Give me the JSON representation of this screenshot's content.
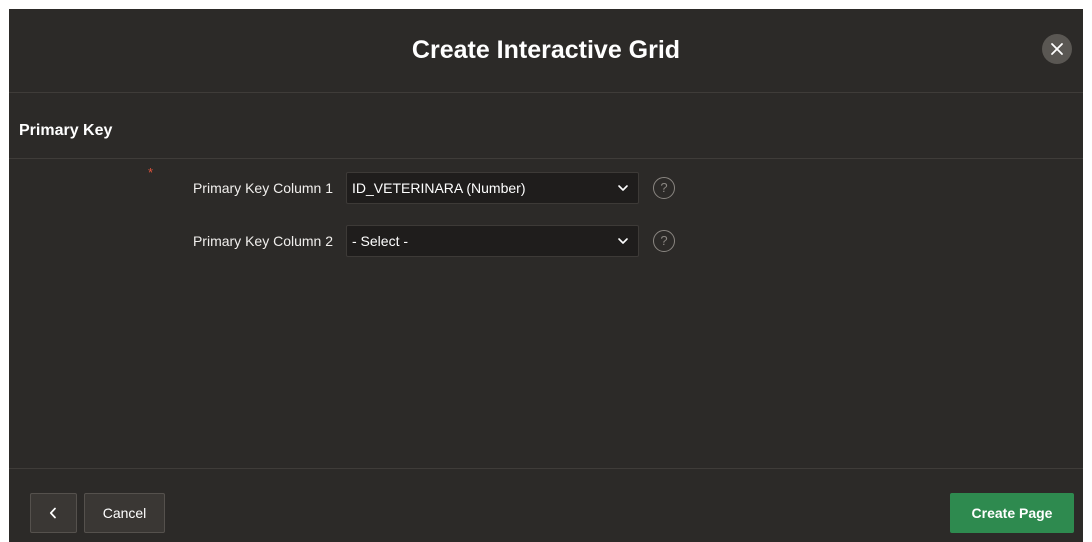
{
  "dialog": {
    "title": "Create Interactive Grid",
    "close_icon": "close-icon"
  },
  "section": {
    "title": "Primary Key"
  },
  "fields": [
    {
      "label": "Primary Key Column 1",
      "required": true,
      "required_marker": "*",
      "value": "ID_VETERINARA (Number)",
      "help_icon": "help-icon",
      "help_glyph": "?"
    },
    {
      "label": "Primary Key Column 2",
      "required": false,
      "value": "- Select -",
      "help_icon": "help-icon",
      "help_glyph": "?"
    }
  ],
  "footer": {
    "back_icon": "chevron-left-icon",
    "cancel_label": "Cancel",
    "create_label": "Create Page"
  },
  "colors": {
    "dialog_bg": "#2c2a28",
    "primary_button": "#2e8a4f",
    "required": "#e0543c"
  }
}
